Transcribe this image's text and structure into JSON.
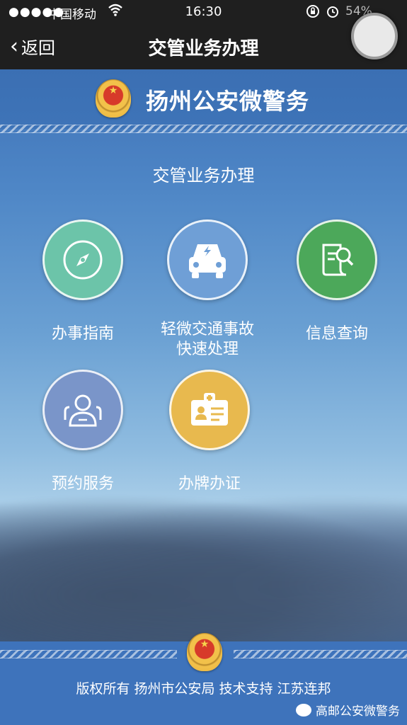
{
  "status_bar": {
    "signal": "●●●●●",
    "carrier": "中国移动",
    "time": "16:30",
    "battery": "54%"
  },
  "nav": {
    "back_label": "返回",
    "title": "交管业务办理"
  },
  "header": {
    "brand": "扬州公安微警务"
  },
  "section": {
    "title": "交管业务办理"
  },
  "tiles": [
    {
      "label": "办事指南",
      "color": "#6cc4a9",
      "icon": "compass-icon"
    },
    {
      "label": "轻微交通事故\n快速处理",
      "color": "#6f9fd6",
      "icon": "car-icon"
    },
    {
      "label": "信息查询",
      "color": "#4ca85a",
      "icon": "document-search-icon"
    },
    {
      "label": "预约服务",
      "color": "#7a95c9",
      "icon": "users-icon"
    },
    {
      "label": "办牌办证",
      "color": "#e8b94e",
      "icon": "id-card-icon"
    }
  ],
  "footer": {
    "text": "版权所有 扬州市公安局 技术支持 江苏连邦",
    "watermark": "高邮公安微警务"
  }
}
